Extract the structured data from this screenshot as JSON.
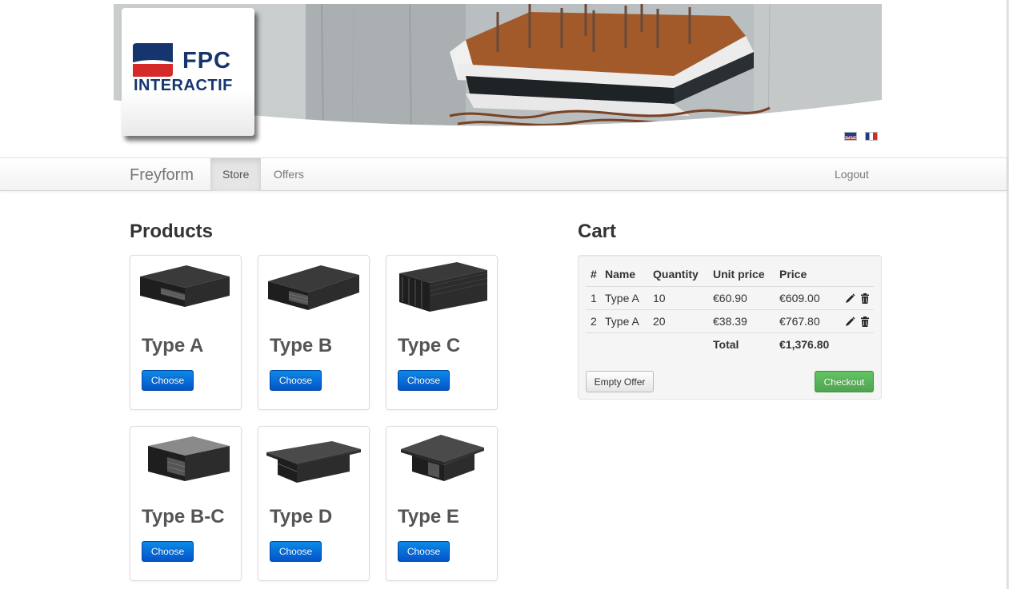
{
  "logo": {
    "line1": "FPC",
    "line2": "INTERACTIF",
    "accent_blue": "#16356e",
    "accent_red": "#d42a2a"
  },
  "languages": [
    {
      "name": "uk-flag-icon"
    },
    {
      "name": "fr-flag-icon"
    }
  ],
  "navbar": {
    "brand": "Freyform",
    "items": [
      {
        "label": "Store",
        "active": true
      },
      {
        "label": "Offers",
        "active": false
      }
    ],
    "logout": "Logout"
  },
  "products": {
    "heading": "Products",
    "choose_label": "Choose",
    "items": [
      {
        "title": "Type A"
      },
      {
        "title": "Type B"
      },
      {
        "title": "Type C"
      },
      {
        "title": "Type B-C"
      },
      {
        "title": "Type D"
      },
      {
        "title": "Type E"
      }
    ]
  },
  "cart": {
    "heading": "Cart",
    "columns": [
      "#",
      "Name",
      "Quantity",
      "Unit price",
      "Price"
    ],
    "rows": [
      {
        "index": "1",
        "name": "Type A",
        "quantity": "10",
        "unit_price": "€60.90",
        "price": "€609.00"
      },
      {
        "index": "2",
        "name": "Type A",
        "quantity": "20",
        "unit_price": "€38.39",
        "price": "€767.80"
      }
    ],
    "total_label": "Total",
    "total_value": "€1,376.80",
    "empty_label": "Empty Offer",
    "checkout_label": "Checkout",
    "row_icons": [
      "pencil-icon",
      "trash-icon"
    ]
  }
}
